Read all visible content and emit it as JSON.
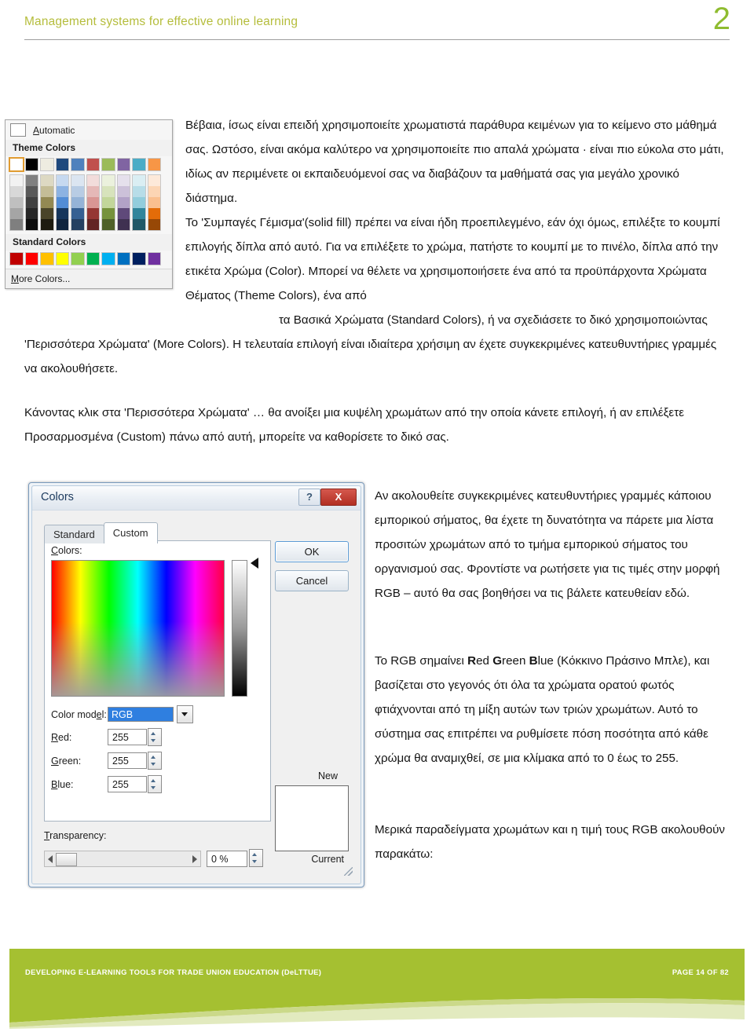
{
  "header": {
    "title": "Management systems for effective online learning",
    "page_number": "2",
    "title_color": "#b5bd3c",
    "page_number_color": "#8fbc30"
  },
  "color_dropdown": {
    "automatic_label": "Automatic",
    "theme_colors_label": "Theme Colors",
    "standard_colors_label": "Standard Colors",
    "more_colors_label": "More Colors...",
    "theme_base_colors": [
      "#ffffff",
      "#000000",
      "#eeece1",
      "#1f497d",
      "#4f81bd",
      "#c0504d",
      "#9bbb59",
      "#8064a2",
      "#4bacc6",
      "#f79646"
    ],
    "theme_shade_columns": [
      [
        "#f2f2f2",
        "#d8d8d8",
        "#bfbfbf",
        "#a5a5a5",
        "#7f7f7f"
      ],
      [
        "#808080",
        "#595959",
        "#404040",
        "#262626",
        "#0c0c0c"
      ],
      [
        "#ddd9c3",
        "#c4bd97",
        "#938953",
        "#494429",
        "#1d1b10"
      ],
      [
        "#c6d9f0",
        "#8db3e2",
        "#538dd5",
        "#16365c",
        "#0f243e"
      ],
      [
        "#dbe5f1",
        "#b8cce4",
        "#95b3d7",
        "#366092",
        "#244061"
      ],
      [
        "#f2dcdb",
        "#e5b8b7",
        "#d99694",
        "#953734",
        "#632423"
      ],
      [
        "#ebf1dd",
        "#d7e3bc",
        "#c2d69a",
        "#76923c",
        "#4f6128"
      ],
      [
        "#e5e0ec",
        "#ccc1d9",
        "#b2a2c7",
        "#5f497a",
        "#3f3151"
      ],
      [
        "#daeef3",
        "#b7dde8",
        "#92cddc",
        "#31859b",
        "#205867"
      ],
      [
        "#fde9d9",
        "#fcd5b4",
        "#fabf8f",
        "#e36c09",
        "#974806"
      ]
    ],
    "standard_colors": [
      "#c00000",
      "#ff0000",
      "#ffc000",
      "#ffff00",
      "#92d050",
      "#00b050",
      "#00b0f0",
      "#0070c0",
      "#002060",
      "#7030a0"
    ]
  },
  "colors_dialog": {
    "title": "Colors",
    "help_label": "?",
    "close_label": "X",
    "tab_standard": "Standard",
    "tab_custom": "Custom",
    "colors_label": "Colors:",
    "ok_label": "OK",
    "cancel_label": "Cancel",
    "color_model_label": "Color model:",
    "color_model_value": "RGB",
    "red_label": "Red:",
    "red_value": "255",
    "green_label": "Green:",
    "green_value": "255",
    "blue_label": "Blue:",
    "blue_value": "255",
    "transparency_label": "Transparency:",
    "transparency_value": "0 %",
    "new_label": "New",
    "current_label": "Current"
  },
  "body": {
    "p1": "Βέβαια, ίσως είναι επειδή χρησιμοποιείτε χρωματιστά παράθυρα κειμένων για το κείμενο στο μάθημά σας. Ωστόσο, είναι ακόμα καλύτερο να χρησιμοποιείτε πιο απαλά χρώματα · είναι πιο εύκολα στο μάτι, ιδίως αν περιμένετε οι εκπαιδευόμενοί σας να διαβάζουν τα μαθήματά σας για μεγάλο χρονικό διάστημα.",
    "p2": "Το 'Συμπαγές Γέμισμα'(solid fill) πρέπει να είναι ήδη προεπιλεγμένο, εάν όχι όμως, επιλέξτε το κουμπί επιλογής δίπλα από αυτό. Για να επιλέξετε το χρώμα, πατήστε το κουμπί με το πινέλο, δίπλα από την ετικέτα Χρώμα (Color). Μπορεί να θέλετε να χρησιμοποιήσετε ένα από τα προϋπάρχοντα Χρώματα Θέματος (Theme Colors), ένα από",
    "p2b": "τα Βασικά Χρώματα (Standard Colors), ή να σχεδιάσετε το δικό χρησιμοποιώντας",
    "p2c": "'Περισσότερα Χρώματα' (More Colors). Η τελευταία επιλογή είναι ιδιαίτερα χρήσιμη αν έχετε συγκεκριμένες κατευθυντήριες γραμμές να ακολουθήσετε.",
    "p3": "Κάνοντας κλικ στα 'Περισσότερα Χρώματα' … θα ανοίξει μια κυψέλη χρωμάτων από την οποία κάνετε επιλογή, ή αν επιλέξετε Προσαρμοσμένα (Custom) πάνω από αυτή, μπορείτε να καθορίσετε το δικό σας.",
    "p4": "Αν ακολουθείτε συγκεκριμένες κατευθυντήριες γραμμές κάποιου εμπορικού σήματος, θα έχετε τη δυνατότητα να πάρετε μια λίστα προσιτών χρωμάτων από το τμήμα εμπορικού σήματος του οργανισμού σας. Φροντίστε να ρωτήσετε για τις τιμές στην μορφή RGB – αυτό θα σας βοηθήσει να τις βάλετε κατευθείαν εδώ.",
    "p5_pre": "Το RGB σημαίνει ",
    "p5_r": "R",
    "p5_ed": "ed ",
    "p5_g": "G",
    "p5_reen": "reen ",
    "p5_b": "B",
    "p5_lue": "lue",
    "p5_post": " (Κόκκινο Πράσινο Μπλε), και βασίζεται στο γεγονός ότι όλα τα χρώματα ορατού φωτός φτιάχνονται από τη μίξη αυτών των τριών χρωμάτων. Αυτό το σύστημα σας επιτρέπει να ρυθμίσετε πόση ποσότητα από κάθε χρώμα θα αναμιχθεί, σε μια κλίμακα από το 0 έως το 255.",
    "p6": "Μερικά παραδείγματα χρωμάτων και η τιμή τους RGB ακολουθούν παρακάτω:"
  },
  "footer": {
    "left_text": "DEVELOPING E-LEARNING TOOLS FOR TRADE UNION EDUCATION (DeLTTUE)",
    "right_text": "PAGE 14 OF 82",
    "band_color": "#a5c031",
    "band_light": "#dde6b4"
  }
}
